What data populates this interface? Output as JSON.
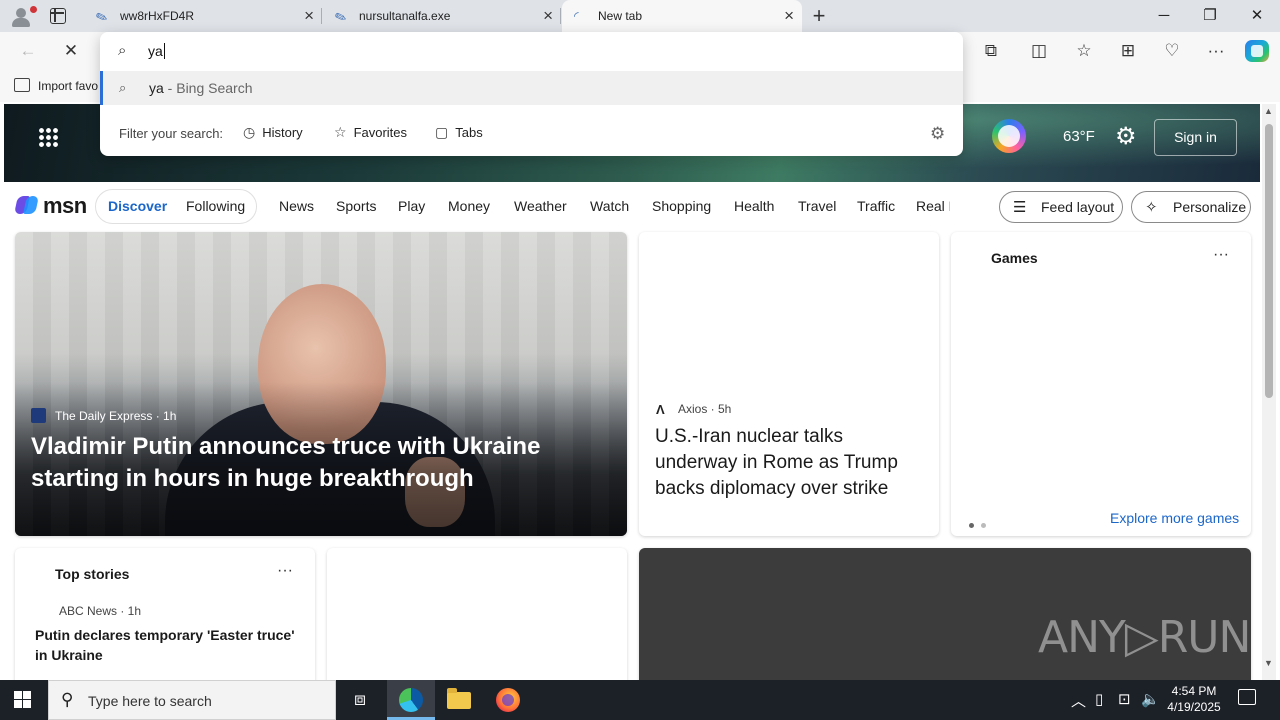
{
  "browser": {
    "tabs": [
      {
        "title": "ww8rHxFD4R",
        "icon": "feather-icon"
      },
      {
        "title": "nursultanalfa.exe",
        "icon": "feather-icon"
      },
      {
        "title": "New tab",
        "icon": "loading-spinner-icon",
        "active": true
      }
    ],
    "favorites_bar": {
      "item_label": "Import favo"
    },
    "omnibox": {
      "query": "ya",
      "suggestion": {
        "query": "ya",
        "suffix": " - Bing Search"
      },
      "filter_label": "Filter your search:",
      "filters": [
        "History",
        "Favorites",
        "Tabs"
      ]
    },
    "window_controls": {
      "minimize": "─",
      "restore": "❐",
      "close": "✕"
    }
  },
  "msn": {
    "brand": "msn",
    "weather_temp": "63°F",
    "sign_in": "Sign in",
    "nav_primary": [
      "Discover",
      "Following"
    ],
    "nav_items": [
      "News",
      "Sports",
      "Play",
      "Money",
      "Weather",
      "Watch",
      "Shopping",
      "Health",
      "Travel",
      "Traffic",
      "Real E"
    ],
    "feed_layout": "Feed layout",
    "personalize": "Personalize"
  },
  "cards": {
    "hero": {
      "source": "The Daily Express · 1h",
      "title": "Vladimir Putin announces truce with Ukraine starting in hours in huge breakthrough"
    },
    "axios": {
      "source": "Axios · 5h",
      "title": "U.S.-Iran nuclear talks underway in Rome as Trump backs diplomacy over strike"
    },
    "games": {
      "title": "Games",
      "more": "···",
      "link": "Explore more games"
    },
    "top_stories": {
      "title": "Top stories",
      "more": "···",
      "source": "ABC News · 1h",
      "headline": "Putin declares temporary 'Easter truce' in Ukraine"
    },
    "watermark": "ANY▷RUN"
  },
  "taskbar": {
    "search_placeholder": "Type here to search",
    "time": "4:54 PM",
    "date": "4/19/2025"
  },
  "colors": {
    "accent": "#1b66c9",
    "taskbar": "#1c2027",
    "omnibox_highlight": "#2b6fd6"
  }
}
